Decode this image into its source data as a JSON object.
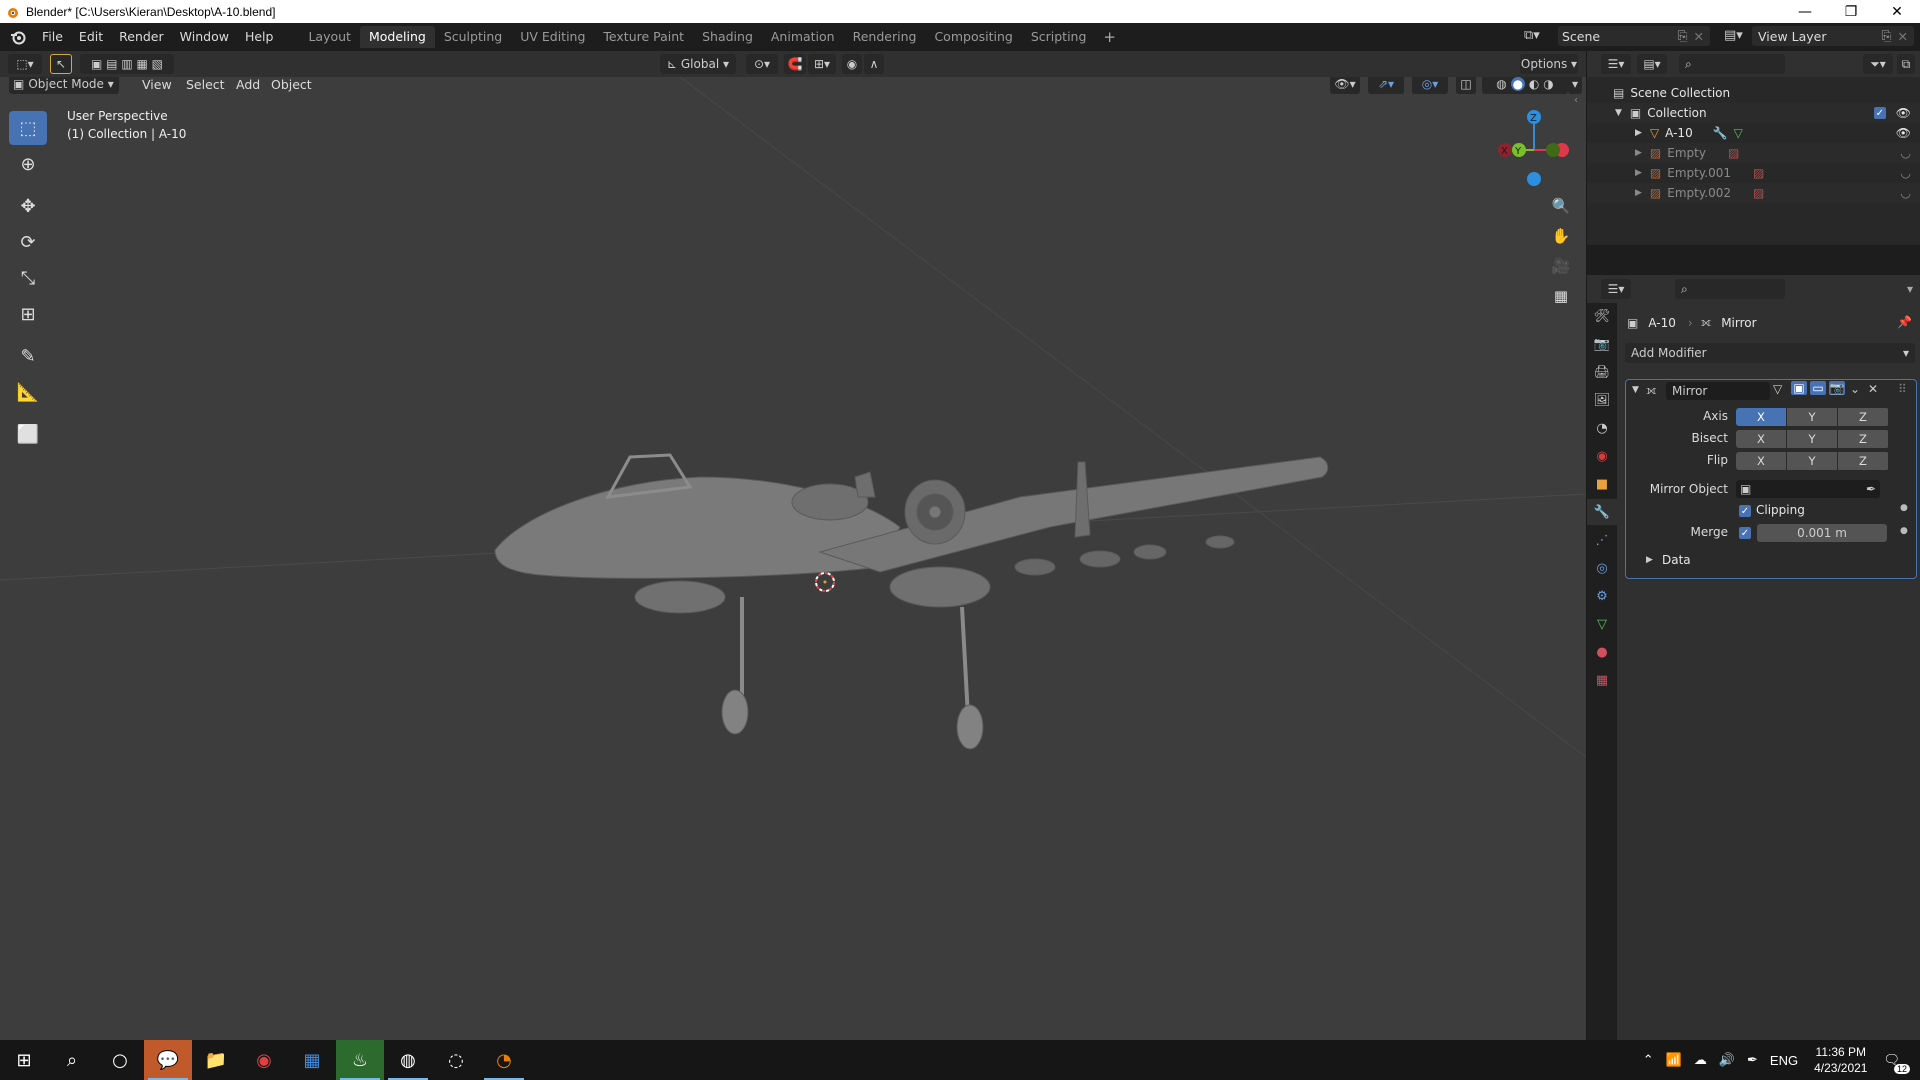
{
  "window": {
    "title": "Blender* [C:\\Users\\Kieran\\Desktop\\A-10.blend]",
    "minimize": "—",
    "restore": "❐",
    "close": "✕"
  },
  "topbar": {
    "menus": [
      "File",
      "Edit",
      "Render",
      "Window",
      "Help"
    ],
    "workspaces": [
      "Layout",
      "Modeling",
      "Sculpting",
      "UV Editing",
      "Texture Paint",
      "Shading",
      "Animation",
      "Rendering",
      "Compositing",
      "Scripting"
    ],
    "active_workspace": "Modeling",
    "add_workspace": "+",
    "scene": "Scene",
    "view_layer": "View Layer"
  },
  "viewport_header": {
    "orientation": "Global",
    "options": "Options",
    "mode": "Object Mode",
    "menus": [
      "View",
      "Select",
      "Add",
      "Object"
    ]
  },
  "viewport": {
    "perspective": "User Perspective",
    "collection_info": "(1) Collection | A-10",
    "gizmo_axes": {
      "x": "X",
      "y": "Y",
      "z": "Z"
    },
    "colors": {
      "x_axis": "#e0384b",
      "y_axis": "#7bc02a",
      "z_axis": "#2c8fdf"
    }
  },
  "outliner": {
    "items": [
      {
        "label": "Scene Collection",
        "level": 0
      },
      {
        "label": "Collection",
        "level": 1
      },
      {
        "label": "A-10",
        "level": 2
      },
      {
        "label": "Empty",
        "level": 2
      },
      {
        "label": "Empty.001",
        "level": 2
      },
      {
        "label": "Empty.002",
        "level": 2
      }
    ]
  },
  "properties": {
    "breadcrumb_object": "A-10",
    "breadcrumb_modifier": "Mirror",
    "add_modifier": "Add Modifier",
    "modifier_name": "Mirror",
    "axis_label": "Axis",
    "bisect_label": "Bisect",
    "flip_label": "Flip",
    "xyz": [
      "X",
      "Y",
      "Z"
    ],
    "mirror_object_label": "Mirror Object",
    "clipping_label": "Clipping",
    "merge_label": "Merge",
    "merge_value": "0.001 m",
    "data_label": "Data"
  },
  "taskbar": {
    "language": "ENG",
    "time": "11:36 PM",
    "date": "4/23/2021",
    "notification_count": "12"
  }
}
